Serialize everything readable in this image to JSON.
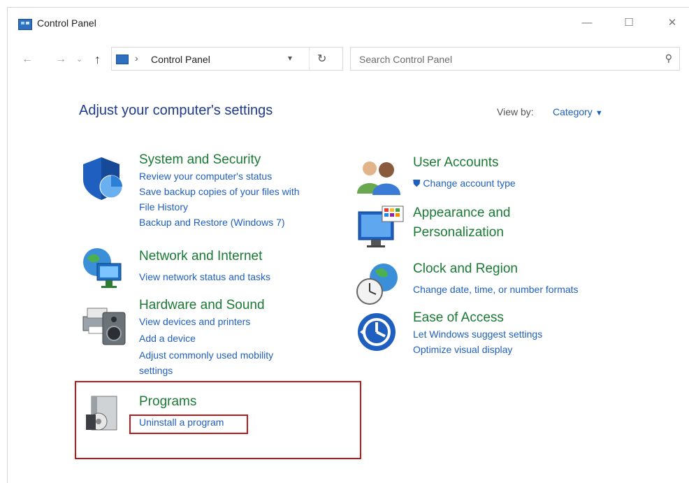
{
  "window": {
    "title": "Control Panel"
  },
  "address": {
    "path": "Control Panel"
  },
  "search": {
    "placeholder": "Search Control Panel"
  },
  "main": {
    "heading": "Adjust your computer's settings",
    "view_by_label": "View by:",
    "view_by_value": "Category"
  },
  "categories": [
    {
      "title": "System and Security",
      "links": [
        "Review your computer's status",
        "Save backup copies of your files with",
        "File History",
        "Backup and Restore (Windows 7)"
      ]
    },
    {
      "title": "Network and Internet",
      "links": [
        "View network status and tasks"
      ]
    },
    {
      "title": "Hardware and Sound",
      "links": [
        "View devices and printers",
        "Add a device",
        "Adjust commonly used mobility",
        "settings"
      ]
    },
    {
      "title": "Programs",
      "links": [
        "Uninstall a program"
      ]
    },
    {
      "title": "User Accounts",
      "links": [
        "Change account type"
      ]
    },
    {
      "title_line1": "Appearance and",
      "title_line2": "Personalization"
    },
    {
      "title": "Clock and Region",
      "links": [
        "Change date, time, or number formats"
      ]
    },
    {
      "title": "Ease of Access",
      "links": [
        "Let Windows suggest settings",
        "Optimize visual display"
      ]
    }
  ],
  "colors": {
    "heading": "#1e3a8a",
    "category_title": "#1a7a34",
    "link": "#1f5fbf",
    "highlight": "#b71c1c"
  }
}
